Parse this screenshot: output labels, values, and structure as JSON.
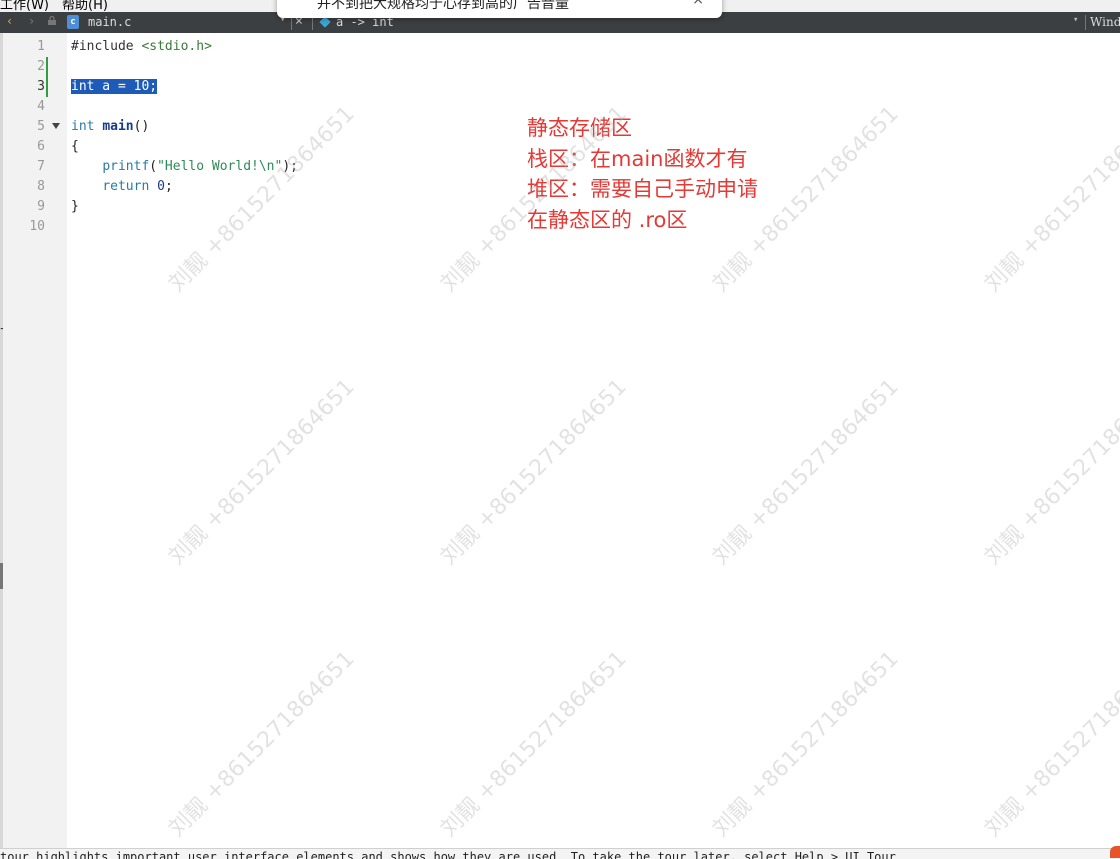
{
  "menubar": {
    "items": [
      "工作(W)",
      "帮助(H)"
    ]
  },
  "popup": {
    "text": "并不到把大规格均于心存到高的广告音量",
    "close": "×"
  },
  "tabbar": {
    "back": "‹",
    "forward": "›",
    "file_badge": "c",
    "filename": "main.c",
    "dropdown": "▾",
    "close": "×",
    "symbol": "a -> int",
    "window_dropdown": "▾",
    "window_label": "Windo"
  },
  "gutter": {
    "line_numbers": [
      "1",
      "2",
      "3",
      "4",
      "5",
      "6",
      "7",
      "8",
      "9",
      "10"
    ],
    "current_line": "3"
  },
  "code": {
    "l1_directive": "#include",
    "l1_header": " <stdio.h>",
    "l3_selected": "int a = 10;",
    "l5_kw": "int",
    "l5_fn": "main",
    "l5_rest": "()",
    "l6": "{",
    "l7_fn": "printf",
    "l7_open": "(",
    "l7_str": "\"Hello World!\\n\"",
    "l7_close": ");",
    "l8_kw": "return",
    "l8_num": "0",
    "l8_end": ";",
    "l9": "}"
  },
  "notes": [
    "静态存储区",
    "栈区：在main函数才有",
    "堆区：需要自己手动申请",
    "在静态区的 .ro区"
  ],
  "watermark": "刘靓 +8615271864651",
  "status": {
    "text": "tour highlights important user interface elements and shows how they are used. To take the tour later, select Help > UI Tour."
  },
  "colors": {
    "note": "#e53935",
    "selection": "#1e5bb8",
    "change_bar": "#2e9e40",
    "tabbar_bg": "#3c3f41"
  }
}
